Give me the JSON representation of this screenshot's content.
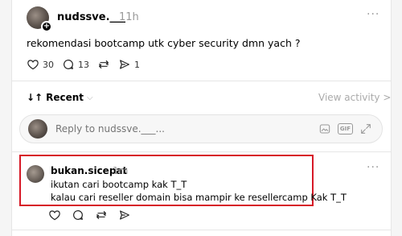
{
  "post": {
    "username": "nudssve.___",
    "time": "11h",
    "more": "···",
    "text": "rekomendasi bootcamp utk cyber security dmn yach ?",
    "likes": "30",
    "comments": "13",
    "shares": "1"
  },
  "sort": {
    "label": "Recent",
    "icon": "↓↑"
  },
  "view_activity": "View activity >",
  "reply": {
    "placeholder": "Reply to nudssve.___..."
  },
  "comment": {
    "username": "bukan.sicepat",
    "time": "1m",
    "more": "···",
    "line1": "ikutan cari bootcamp kak T_T",
    "line2": "kalau cari reseller domain bisa mampir ke resellercamp Kak T_T"
  },
  "colors": {
    "highlight_border": "#d71927",
    "muted_text": "#999999"
  }
}
